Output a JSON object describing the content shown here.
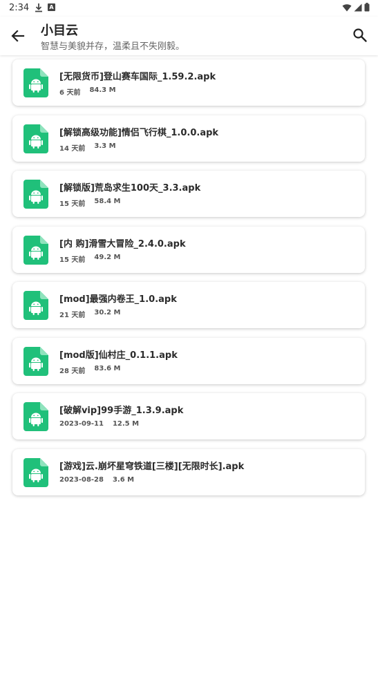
{
  "status": {
    "time": "2:34",
    "download_icon": "download-icon",
    "notif_badge": "A"
  },
  "app_bar": {
    "title": "小目云",
    "subtitle": "智慧与美貌并存，温柔且不失刚毅。"
  },
  "files": [
    {
      "name": "[无限货币]登山赛车国际_1.59.2.apk",
      "time": "6 天前",
      "size": "84.3 M"
    },
    {
      "name": "[解锁高级功能]情侣飞行棋_1.0.0.apk",
      "time": "14 天前",
      "size": "3.3 M"
    },
    {
      "name": "[解锁版]荒岛求生100天_3.3.apk",
      "time": "15 天前",
      "size": "58.4 M"
    },
    {
      "name": "[内 购]滑雪大冒险_2.4.0.apk",
      "time": "15 天前",
      "size": "49.2 M"
    },
    {
      "name": "[mod]最强内卷王_1.0.apk",
      "time": "21 天前",
      "size": "30.2 M"
    },
    {
      "name": "[mod版]仙村庄_0.1.1.apk",
      "time": "28 天前",
      "size": "83.6 M"
    },
    {
      "name": "[破解vip]99手游_1.3.9.apk",
      "time": "2023-09-11",
      "size": "12.5 M"
    },
    {
      "name": "[游戏]云.崩坏星穹铁道[三楼][无限时长].apk",
      "time": "2023-08-28",
      "size": "3.6 M"
    }
  ],
  "colors": {
    "file_icon_green": "#20c07a",
    "file_icon_fold": "#8fe3bd"
  }
}
